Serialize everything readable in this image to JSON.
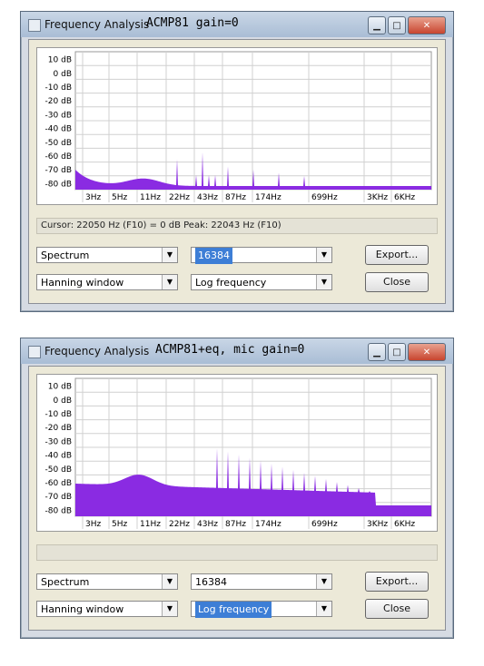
{
  "windows": [
    {
      "title": "Frequency Analysis",
      "overlay_label": "ACMP81 gain=0",
      "y_ticks": [
        "10 dB",
        "0 dB",
        "-10 dB",
        "-20 dB",
        "-30 dB",
        "-40 dB",
        "-50 dB",
        "-60 dB",
        "-70 dB",
        "-80 dB"
      ],
      "x_ticks": [
        "3Hz",
        "5Hz",
        "11Hz",
        "22Hz",
        "43Hz",
        "87Hz",
        "174Hz",
        "699Hz",
        "3KHz",
        "6KHz"
      ],
      "status_text": "Cursor: 22050 Hz (F10) = 0 dB   Peak: 22043 Hz (F10)",
      "algorithm": "Spectrum",
      "window_func": "Hanning window",
      "size": "16384",
      "axis": "Log frequency",
      "export_label": "Export...",
      "close_label": "Close",
      "plot_color": "#8a2be2"
    },
    {
      "title": "Frequency Analysis",
      "overlay_label": "ACMP81+eq, mic gain=0",
      "y_ticks": [
        "10 dB",
        "0 dB",
        "-10 dB",
        "-20 dB",
        "-30 dB",
        "-40 dB",
        "-50 dB",
        "-60 dB",
        "-70 dB",
        "-80 dB"
      ],
      "x_ticks": [
        "3Hz",
        "5Hz",
        "11Hz",
        "22Hz",
        "43Hz",
        "87Hz",
        "174Hz",
        "699Hz",
        "3KHz",
        "6KHz"
      ],
      "status_text": "",
      "algorithm": "Spectrum",
      "window_func": "Hanning window",
      "size": "16384",
      "axis": "Log frequency",
      "export_label": "Export...",
      "close_label": "Close",
      "plot_color": "#8a2be2"
    }
  ]
}
